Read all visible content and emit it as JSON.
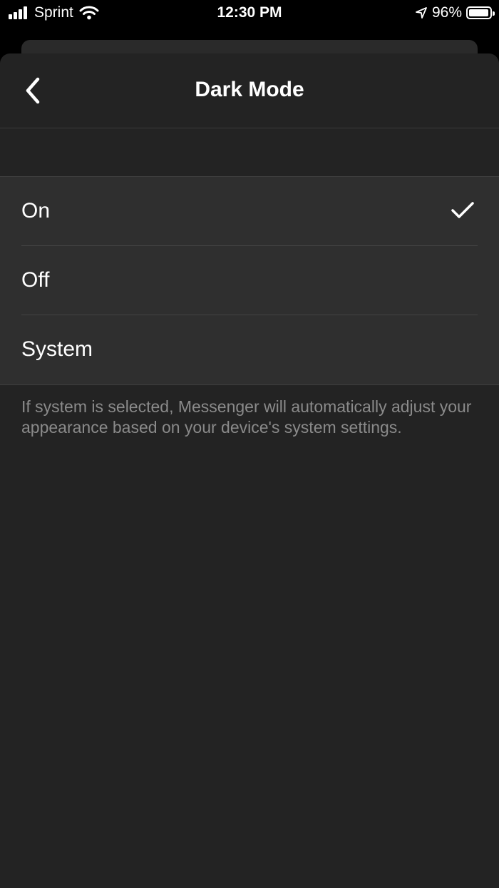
{
  "status_bar": {
    "carrier": "Sprint",
    "time": "12:30 PM",
    "battery_percent": "96%",
    "battery_level": 0.96,
    "icons": [
      "signal-icon",
      "wifi-icon",
      "location-arrow-icon",
      "battery-icon"
    ]
  },
  "nav": {
    "title": "Dark Mode",
    "back_icon": "chevron-left-icon"
  },
  "options": [
    {
      "label": "On",
      "selected": true
    },
    {
      "label": "Off",
      "selected": false
    },
    {
      "label": "System",
      "selected": false
    }
  ],
  "footnote": "If system is selected, Messenger will automatically adjust your appearance based on your device's system settings.",
  "colors": {
    "background": "#232323",
    "row_background": "#2f2f2f",
    "text": "#ffffff",
    "secondary_text": "#8a8a8a"
  }
}
